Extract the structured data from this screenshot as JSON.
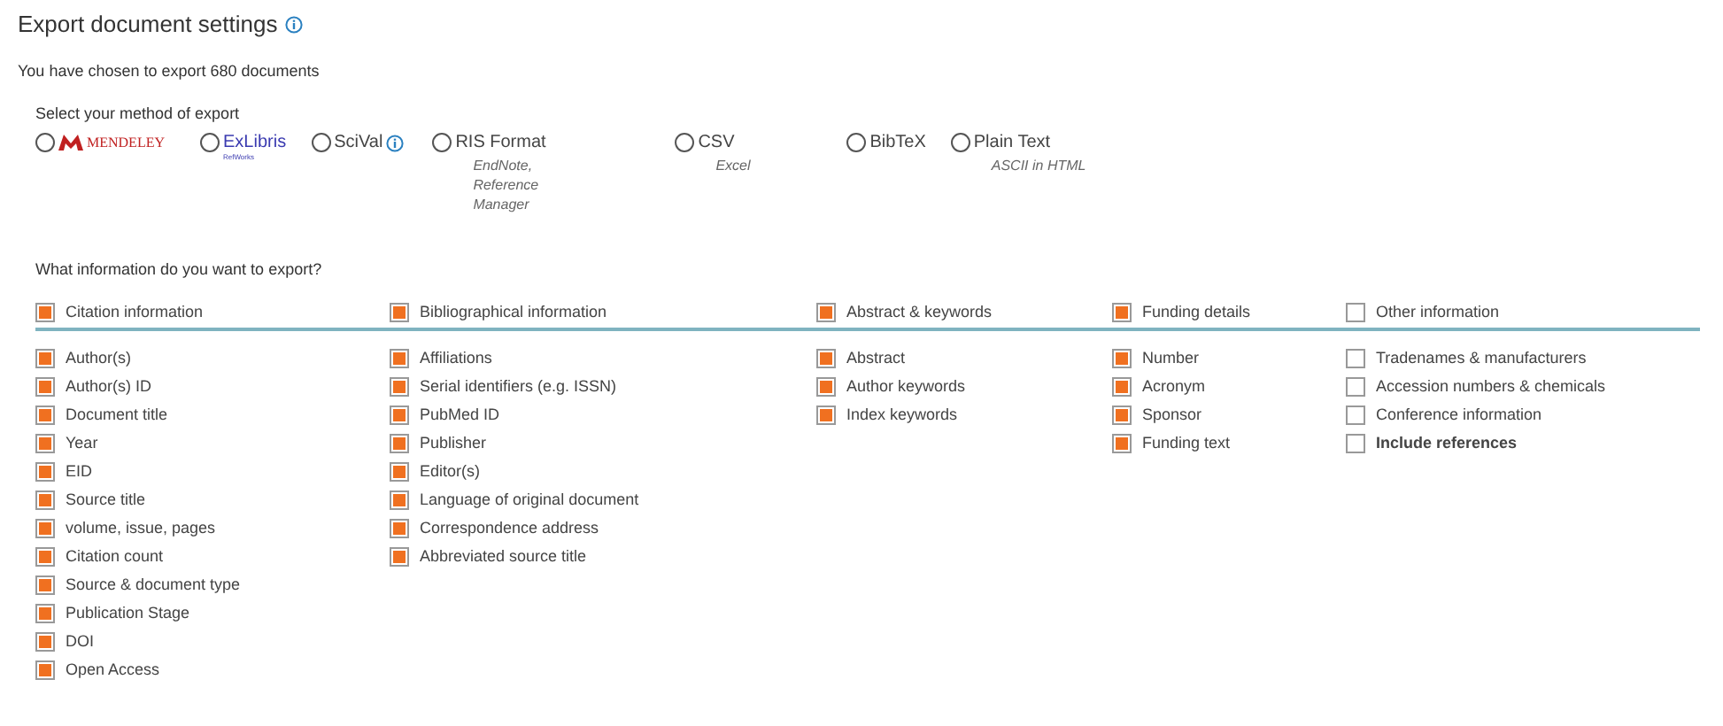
{
  "title": "Export document settings",
  "summary": "You have chosen to export 680 documents",
  "export_method": {
    "label": "Select your method of export",
    "options": [
      {
        "kind": "mendeley",
        "label": "MENDELEY",
        "selected": false
      },
      {
        "kind": "exlibris",
        "label": "ExLibris",
        "sublabel": "RefWorks",
        "selected": false
      },
      {
        "kind": "info",
        "label": "SciVal",
        "selected": false
      },
      {
        "kind": "text",
        "label": "RIS Format",
        "sublabel": "EndNote, Reference Manager",
        "selected": false
      },
      {
        "kind": "text",
        "label": "CSV",
        "sublabel": "Excel",
        "selected": false
      },
      {
        "kind": "text",
        "label": "BibTeX",
        "selected": false
      },
      {
        "kind": "text",
        "label": "Plain Text",
        "sublabel": "ASCII in HTML",
        "selected": false
      }
    ]
  },
  "question": "What information do you want to export?",
  "groups": [
    {
      "label": "Citation information",
      "checked": true,
      "items": [
        {
          "label": "Author(s)",
          "checked": true
        },
        {
          "label": "Author(s) ID",
          "checked": true
        },
        {
          "label": "Document title",
          "checked": true
        },
        {
          "label": "Year",
          "checked": true
        },
        {
          "label": "EID",
          "checked": true
        },
        {
          "label": "Source title",
          "checked": true
        },
        {
          "label": "volume, issue, pages",
          "checked": true
        },
        {
          "label": "Citation count",
          "checked": true
        },
        {
          "label": "Source & document type",
          "checked": true
        },
        {
          "label": "Publication Stage",
          "checked": true
        },
        {
          "label": "DOI",
          "checked": true
        },
        {
          "label": "Open Access",
          "checked": true
        }
      ]
    },
    {
      "label": "Bibliographical information",
      "checked": true,
      "items": [
        {
          "label": "Affiliations",
          "checked": true
        },
        {
          "label": "Serial identifiers (e.g. ISSN)",
          "checked": true
        },
        {
          "label": "PubMed ID",
          "checked": true
        },
        {
          "label": "Publisher",
          "checked": true
        },
        {
          "label": "Editor(s)",
          "checked": true
        },
        {
          "label": "Language of original document",
          "checked": true
        },
        {
          "label": "Correspondence address",
          "checked": true
        },
        {
          "label": "Abbreviated source title",
          "checked": true
        }
      ]
    },
    {
      "label": "Abstract & keywords",
      "checked": true,
      "items": [
        {
          "label": "Abstract",
          "checked": true
        },
        {
          "label": "Author keywords",
          "checked": true
        },
        {
          "label": "Index keywords",
          "checked": true
        }
      ]
    },
    {
      "label": "Funding details",
      "checked": true,
      "items": [
        {
          "label": "Number",
          "checked": true
        },
        {
          "label": "Acronym",
          "checked": true
        },
        {
          "label": "Sponsor",
          "checked": true
        },
        {
          "label": "Funding text",
          "checked": true
        }
      ]
    },
    {
      "label": "Other information",
      "checked": false,
      "items": [
        {
          "label": "Tradenames & manufacturers",
          "checked": false
        },
        {
          "label": "Accession numbers & chemicals",
          "checked": false
        },
        {
          "label": "Conference information",
          "checked": false
        },
        {
          "label": "Include references",
          "checked": false,
          "emphasis": true
        }
      ]
    }
  ]
}
